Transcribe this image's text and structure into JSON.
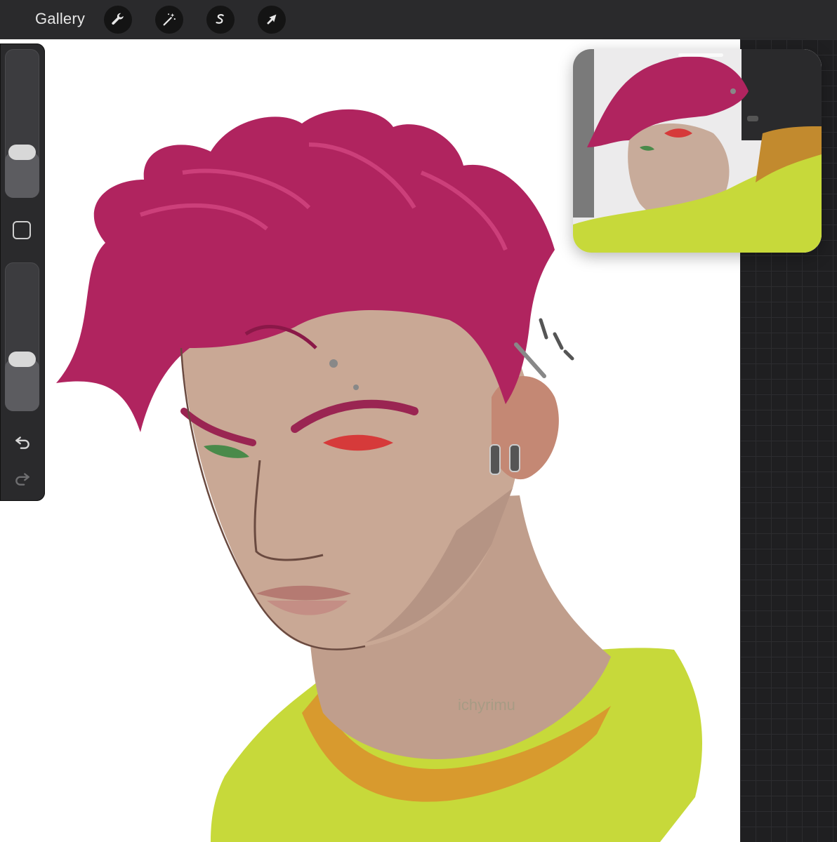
{
  "toolbar": {
    "gallery_label": "Gallery",
    "tools": [
      {
        "name": "actions",
        "icon": "wrench-icon"
      },
      {
        "name": "adjustments",
        "icon": "magic-wand-icon"
      },
      {
        "name": "selection",
        "icon": "selection-s-icon"
      },
      {
        "name": "transform",
        "icon": "arrow-cursor-icon"
      }
    ]
  },
  "sidebar": {
    "brush_size_level": 0.27,
    "opacity_level": 0.32,
    "modifier_icon": "square-icon",
    "undo_icon": "undo-icon",
    "redo_icon": "redo-icon"
  },
  "canvas": {
    "signature": "ichyrimu",
    "colors": {
      "hair": "#b0245f",
      "skin": "#c9a895",
      "shirt": "#c7d93a",
      "collar": "#d89a2e",
      "eye": "#d63a3a"
    }
  },
  "reference": {
    "label": "reference-image"
  }
}
